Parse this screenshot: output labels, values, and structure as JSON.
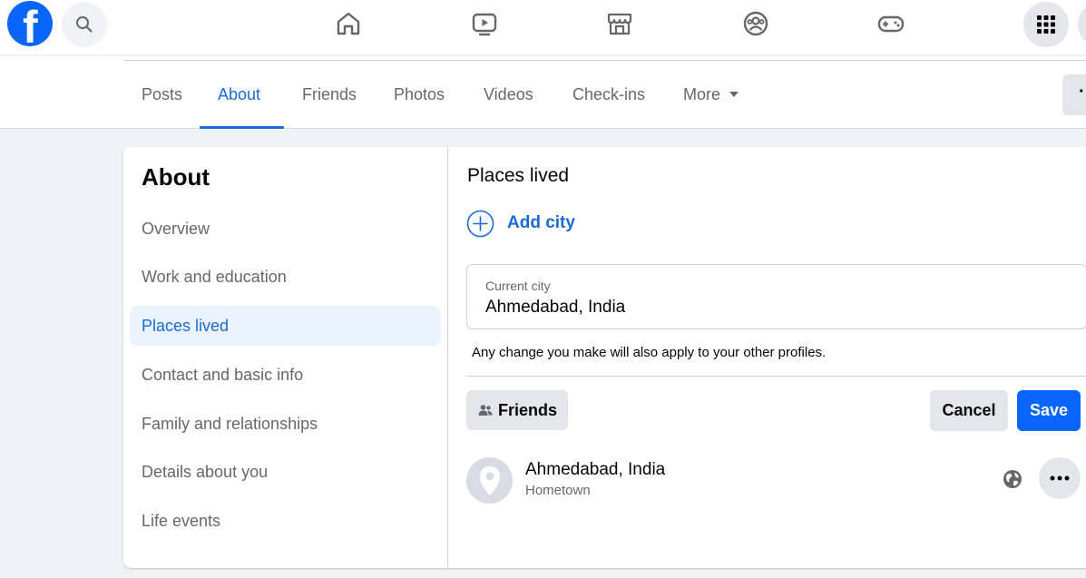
{
  "topbar": {
    "logo_letter": "f",
    "nav_icons": [
      "home-icon",
      "watch-icon",
      "marketplace-icon",
      "groups-icon",
      "gaming-icon"
    ],
    "menu_icon": "apps-grid-icon"
  },
  "profile_tabs": {
    "items": [
      {
        "label": "Posts",
        "active": false
      },
      {
        "label": "About",
        "active": true
      },
      {
        "label": "Friends",
        "active": false
      },
      {
        "label": "Photos",
        "active": false
      },
      {
        "label": "Videos",
        "active": false
      },
      {
        "label": "Check-ins",
        "active": false
      },
      {
        "label": "More",
        "active": false
      }
    ],
    "overflow_label": "···"
  },
  "about_sidebar": {
    "title": "About",
    "items": [
      {
        "label": "Overview"
      },
      {
        "label": "Work and education"
      },
      {
        "label": "Places lived",
        "active": true
      },
      {
        "label": "Contact and basic info"
      },
      {
        "label": "Family and relationships"
      },
      {
        "label": "Details about you"
      },
      {
        "label": "Life events"
      }
    ]
  },
  "places_lived": {
    "title": "Places lived",
    "add_city_label": "Add city",
    "current_city": {
      "label": "Current city",
      "value": "Ahmedabad, India"
    },
    "helper_text": "Any change you make will also apply to your other profiles.",
    "audience_label": "Friends",
    "cancel_label": "Cancel",
    "save_label": "Save",
    "hometown": {
      "name": "Ahmedabad, India",
      "type": "Hometown"
    }
  },
  "colors": {
    "accent": "#1b6ad6",
    "primary_button": "#0866ff",
    "secondary_button": "#e4e6eb",
    "page_background": "#f0f2f5"
  }
}
